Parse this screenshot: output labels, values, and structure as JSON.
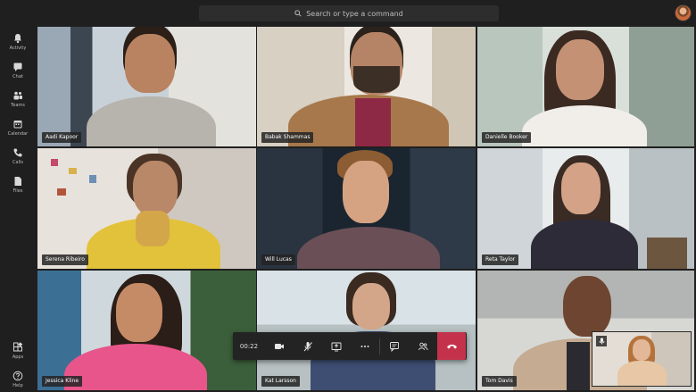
{
  "search": {
    "placeholder": "Search or type a command"
  },
  "rail": [
    {
      "label": "Activity",
      "icon": "bell-icon"
    },
    {
      "label": "Chat",
      "icon": "chat-icon"
    },
    {
      "label": "Teams",
      "icon": "teams-icon"
    },
    {
      "label": "Calendar",
      "icon": "calendar-icon"
    },
    {
      "label": "Calls",
      "icon": "phone-icon"
    },
    {
      "label": "Files",
      "icon": "file-icon"
    },
    {
      "label": "Apps",
      "icon": "apps-icon"
    },
    {
      "label": "Help",
      "icon": "help-icon"
    }
  ],
  "participants": [
    {
      "name": "Aadi Kapoor"
    },
    {
      "name": "Babak Shammas"
    },
    {
      "name": "Danielle Booker"
    },
    {
      "name": "Serena Ribeiro"
    },
    {
      "name": "Will Lucas"
    },
    {
      "name": "Reta Taylor"
    },
    {
      "name": "Jessica Kline"
    },
    {
      "name": "Kat Larsson"
    },
    {
      "name": "Tom Davis"
    }
  ],
  "call": {
    "timer": "00:22",
    "controls": [
      "camera-icon",
      "mic-off-icon",
      "share-screen-icon",
      "more-icon",
      "chat-icon",
      "participants-icon",
      "hang-up-icon"
    ]
  },
  "colors": {
    "hangup": "#c4314b",
    "background": "#1f1f1f"
  }
}
